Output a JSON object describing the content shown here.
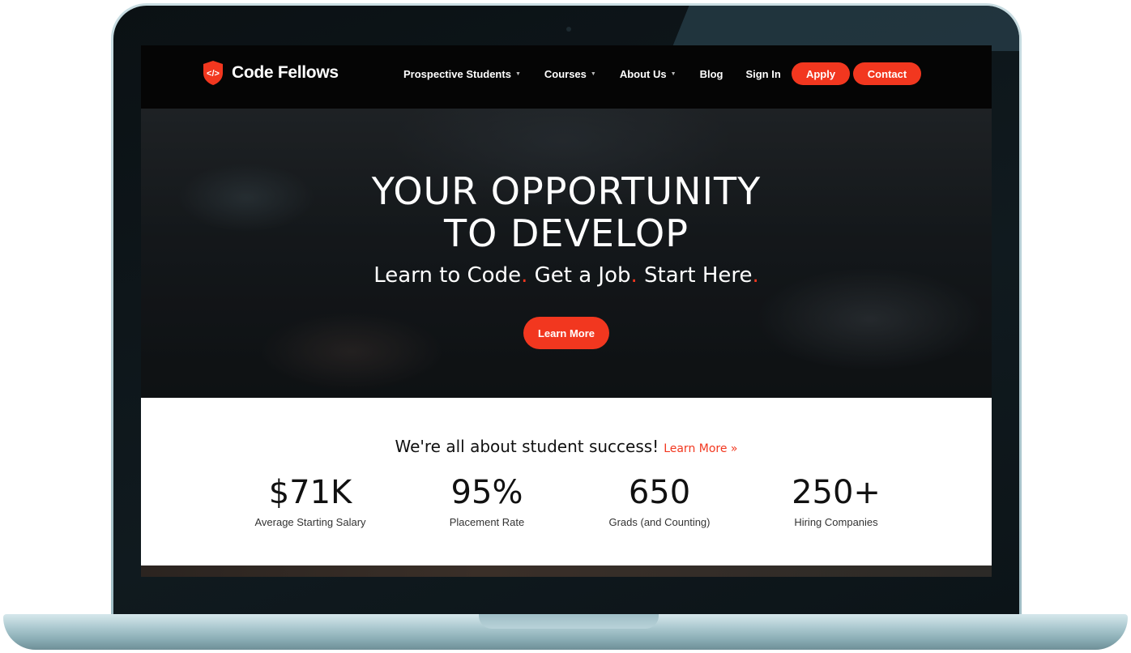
{
  "brand": {
    "name": "Code Fellows",
    "accent_color": "#f2371f",
    "logo_icon": "code-shield-icon",
    "logo_glyph": "</>"
  },
  "nav": {
    "items": [
      {
        "label": "Prospective Students",
        "dropdown": true
      },
      {
        "label": "Courses",
        "dropdown": true
      },
      {
        "label": "About Us",
        "dropdown": true
      },
      {
        "label": "Blog",
        "dropdown": false
      },
      {
        "label": "Sign In",
        "dropdown": false
      }
    ],
    "caret_glyph": "▼",
    "apply_label": "Apply",
    "contact_label": "Contact"
  },
  "hero": {
    "title_line1": "YOUR OPPORTUNITY",
    "title_line2": "TO DEVELOP",
    "subtitle_parts": [
      "Learn to Code",
      "Get a Job",
      "Start Here"
    ],
    "subtitle_separator": ".",
    "cta_label": "Learn More"
  },
  "stats": {
    "headline": "We're all about student success!",
    "headline_link": "Learn More »",
    "items": [
      {
        "value": "$71K",
        "label": "Average Starting Salary"
      },
      {
        "value": "95%",
        "label": "Placement Rate"
      },
      {
        "value": "650",
        "label": "Grads (and Counting)"
      },
      {
        "value": "250+",
        "label": "Hiring Companies"
      }
    ]
  }
}
